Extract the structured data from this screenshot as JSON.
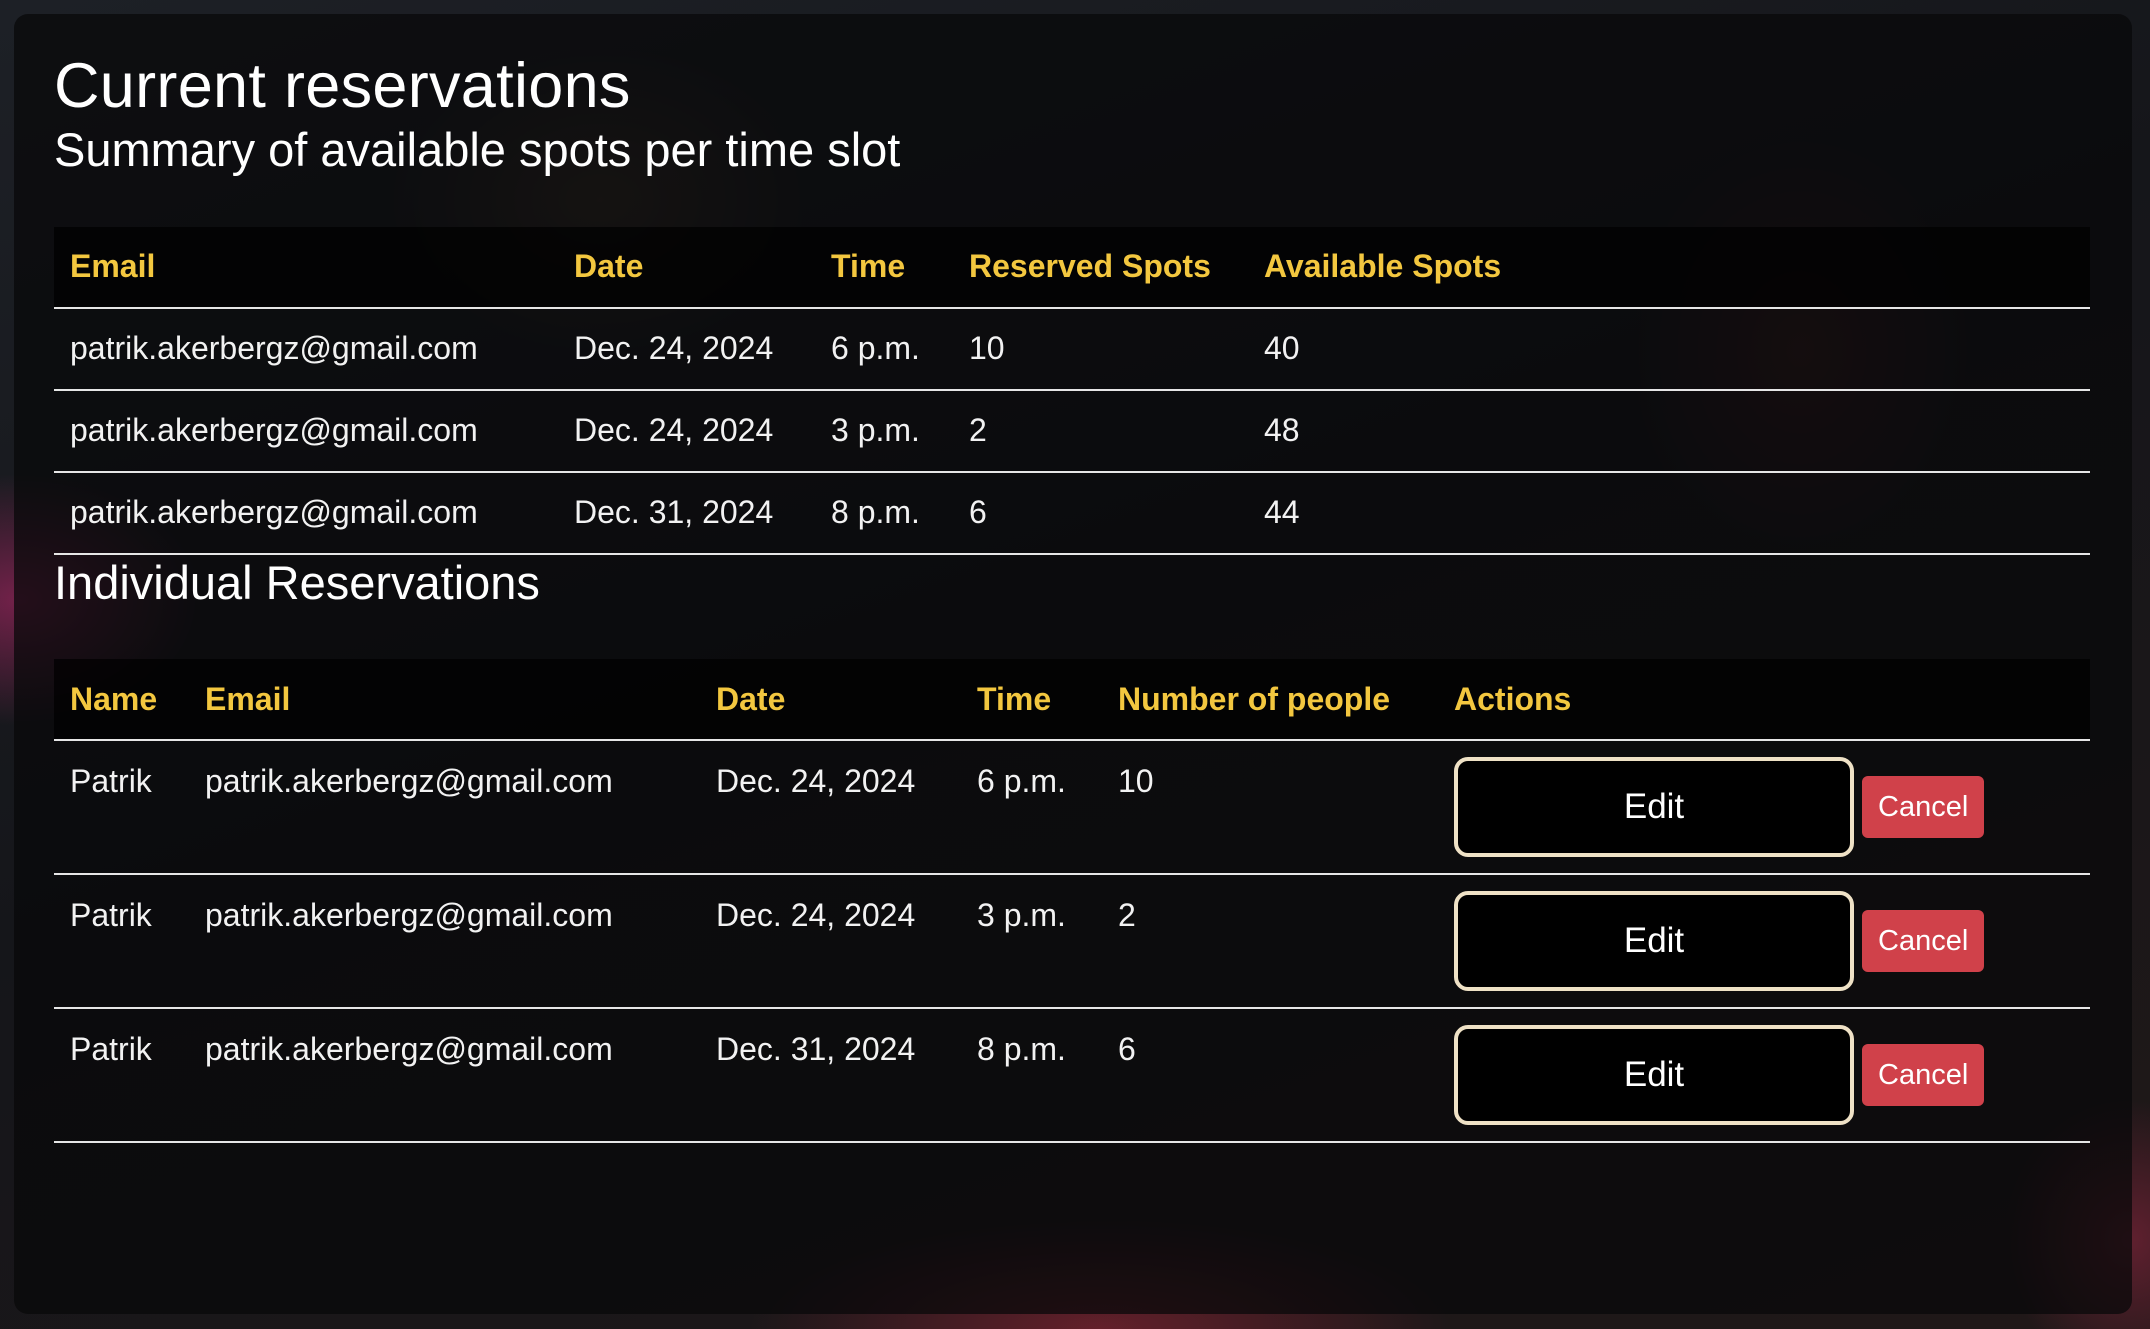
{
  "page": {
    "title": "Current reservations",
    "summary_heading": "Summary of available spots per time slot",
    "individual_heading": "Individual Reservations"
  },
  "summary_table": {
    "columns": [
      "Email",
      "Date",
      "Time",
      "Reserved Spots",
      "Available Spots"
    ],
    "rows": [
      {
        "email": "patrik.akerbergz@gmail.com",
        "date": "Dec. 24, 2024",
        "time": "6 p.m.",
        "reserved": "10",
        "available": "40"
      },
      {
        "email": "patrik.akerbergz@gmail.com",
        "date": "Dec. 24, 2024",
        "time": "3 p.m.",
        "reserved": "2",
        "available": "48"
      },
      {
        "email": "patrik.akerbergz@gmail.com",
        "date": "Dec. 31, 2024",
        "time": "8 p.m.",
        "reserved": "6",
        "available": "44"
      }
    ]
  },
  "individual_table": {
    "columns": [
      "Name",
      "Email",
      "Date",
      "Time",
      "Number of people",
      "Actions"
    ],
    "rows": [
      {
        "name": "Patrik",
        "email": "patrik.akerbergz@gmail.com",
        "date": "Dec. 24, 2024",
        "time": "6 p.m.",
        "people": "10",
        "edit_label": "Edit",
        "cancel_label": "Cancel"
      },
      {
        "name": "Patrik",
        "email": "patrik.akerbergz@gmail.com",
        "date": "Dec. 24, 2024",
        "time": "3 p.m.",
        "people": "2",
        "edit_label": "Edit",
        "cancel_label": "Cancel"
      },
      {
        "name": "Patrik",
        "email": "patrik.akerbergz@gmail.com",
        "date": "Dec. 31, 2024",
        "time": "8 p.m.",
        "people": "6",
        "edit_label": "Edit",
        "cancel_label": "Cancel"
      }
    ]
  },
  "colors": {
    "header_text": "#f3c73f",
    "cancel_button": "#d0414a",
    "edit_border": "#efe2c6"
  }
}
